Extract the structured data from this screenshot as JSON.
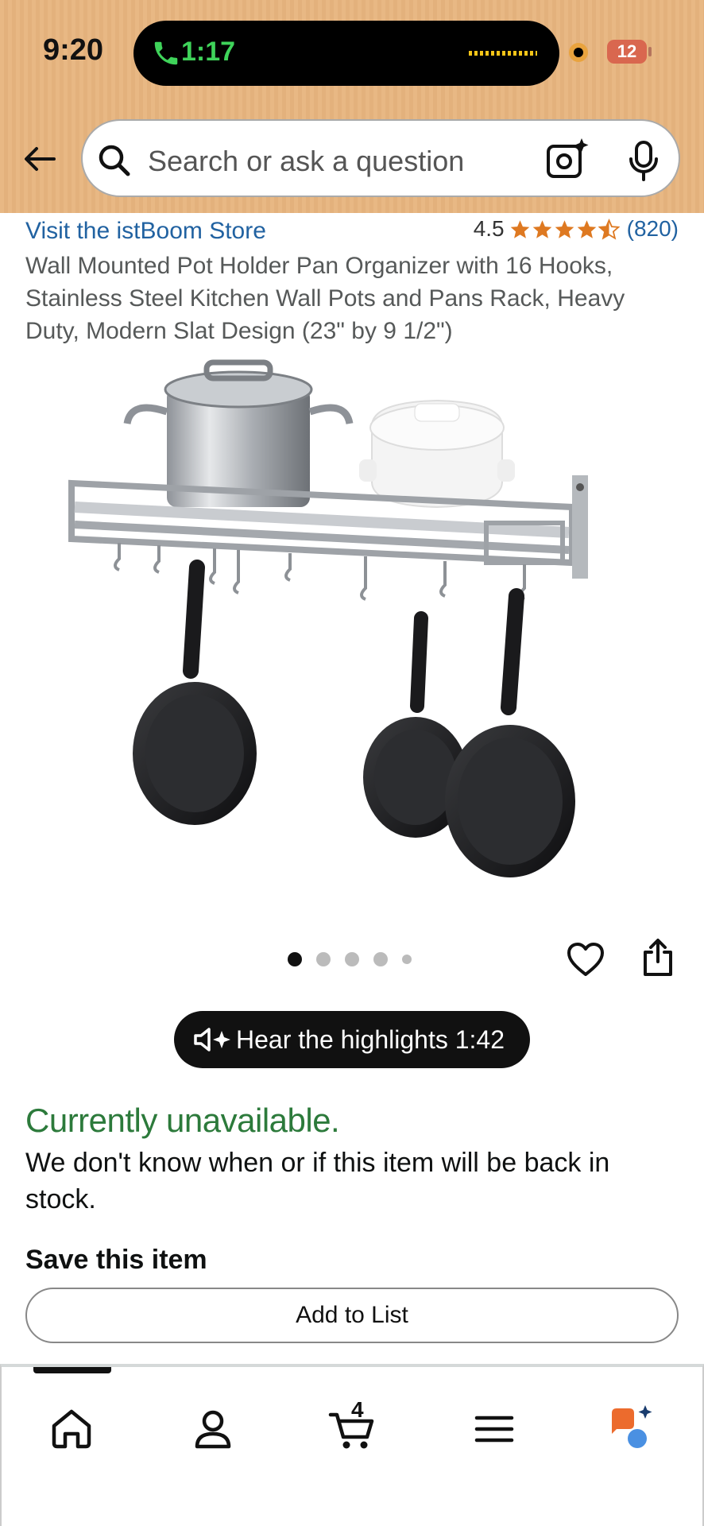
{
  "status_bar": {
    "time": "9:20",
    "call_duration": "1:17",
    "battery_level": "12",
    "colors": {
      "call_green": "#3fd35a",
      "battery_red": "#d9674f",
      "header_bg": "#e8b884"
    }
  },
  "search": {
    "placeholder": "Search or ask a question",
    "icons": [
      "back-arrow-icon",
      "search-icon",
      "camera-icon",
      "microphone-icon"
    ]
  },
  "product": {
    "store_link": "Visit the istBoom Store",
    "rating_value": "4.5",
    "rating_stars": 4.5,
    "rating_count": "(820)",
    "title": "Wall Mounted Pot Holder Pan Organizer with 16 Hooks, Stainless Steel Kitchen Wall Pots and Pans Rack, Heavy Duty, Modern Slat Design (23\" by 9 1/2\")",
    "image_dots_total": 5,
    "image_dot_active": 1
  },
  "highlights": {
    "label": "Hear the highlights 1:42"
  },
  "availability": {
    "status": "Currently unavailable.",
    "message": "We don't know when or if this item will be back in stock.",
    "status_color": "#2c7a3b"
  },
  "save": {
    "heading": "Save this item",
    "button_label": "Add to List"
  },
  "bottom_nav": {
    "items": [
      "home-icon",
      "account-icon",
      "cart-icon",
      "menu-icon",
      "rufus-icon"
    ],
    "cart_count": "4"
  }
}
